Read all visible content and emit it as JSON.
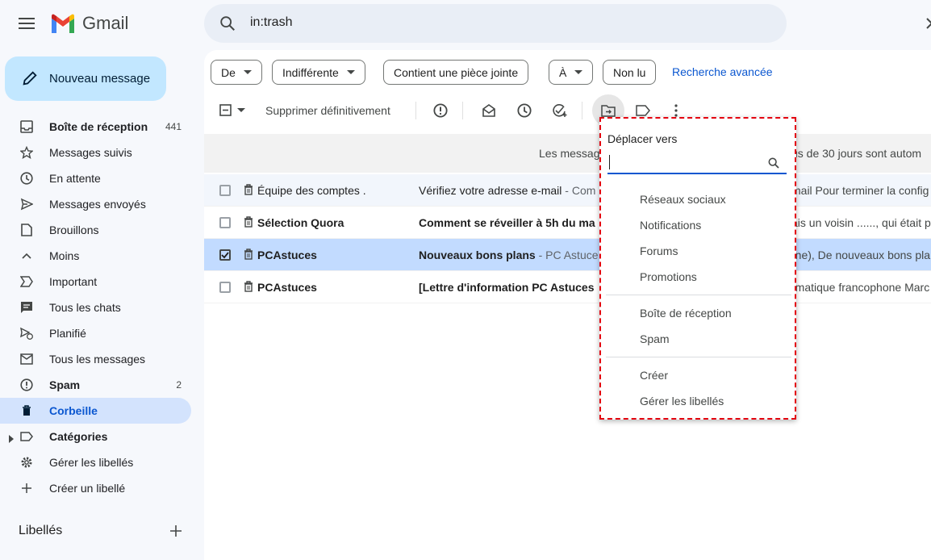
{
  "app": {
    "name": "Gmail"
  },
  "search": {
    "value": "in:trash"
  },
  "compose": {
    "label": "Nouveau message"
  },
  "sidebar": {
    "items": [
      {
        "label": "Boîte de réception",
        "count": "441",
        "bold": true
      },
      {
        "label": "Messages suivis"
      },
      {
        "label": "En attente"
      },
      {
        "label": "Messages envoyés"
      },
      {
        "label": "Brouillons"
      },
      {
        "label": "Moins"
      },
      {
        "label": "Important"
      },
      {
        "label": "Tous les chats"
      },
      {
        "label": "Planifié"
      },
      {
        "label": "Tous les messages"
      },
      {
        "label": "Spam",
        "count": "2",
        "bold": true
      },
      {
        "label": "Corbeille",
        "active": true
      },
      {
        "label": "Catégories",
        "bold": true
      },
      {
        "label": "Gérer les libellés"
      },
      {
        "label": "Créer un libellé"
      }
    ],
    "labels_heading": "Libellés"
  },
  "filters": {
    "from": "De",
    "any_time": "Indifférente",
    "has_attachment": "Contient une pièce jointe",
    "to": "À",
    "unread": "Non lu",
    "advanced": "Recherche avancée"
  },
  "toolbar": {
    "delete_forever": "Supprimer définitivement"
  },
  "notice": {
    "text": "Les messag",
    "text_right": "us de 30 jours sont autom"
  },
  "emails": [
    {
      "sender": "Équipe des comptes .",
      "subject": "Vérifiez votre adresse e-mail",
      "snippet": " - Com",
      "right": "mail Pour terminer la config",
      "read": true,
      "selected": false
    },
    {
      "sender": "Sélection Quora",
      "subject": "Comment se réveiller à 5h du ma",
      "snippet": "",
      "right": "ais un voisin ......, qui était p",
      "read": false,
      "selected": false
    },
    {
      "sender": "PCAstuces",
      "subject": "Nouveaux bons plans",
      "snippet": " - PC Astuce",
      "right": "(ne), De nouveaux bons pla",
      "read": false,
      "selected": true
    },
    {
      "sender": "PCAstuces",
      "subject": "[Lettre d'information PC Astuces",
      "snippet": "",
      "right": "rmatique francophone Marc",
      "read": false,
      "selected": false
    }
  ],
  "move_menu": {
    "title": "Déplacer vers",
    "items_group1": [
      "Réseaux sociaux",
      "Notifications",
      "Forums",
      "Promotions"
    ],
    "items_group2": [
      "Boîte de réception",
      "Spam"
    ],
    "items_group3": [
      "Créer",
      "Gérer les libellés"
    ]
  },
  "colors": {
    "accent": "#0b57d0",
    "compose_bg": "#c2e7ff",
    "active_nav": "#d3e3fd",
    "selected_row": "#c2dbff",
    "highlight_border": "#e3000f"
  }
}
